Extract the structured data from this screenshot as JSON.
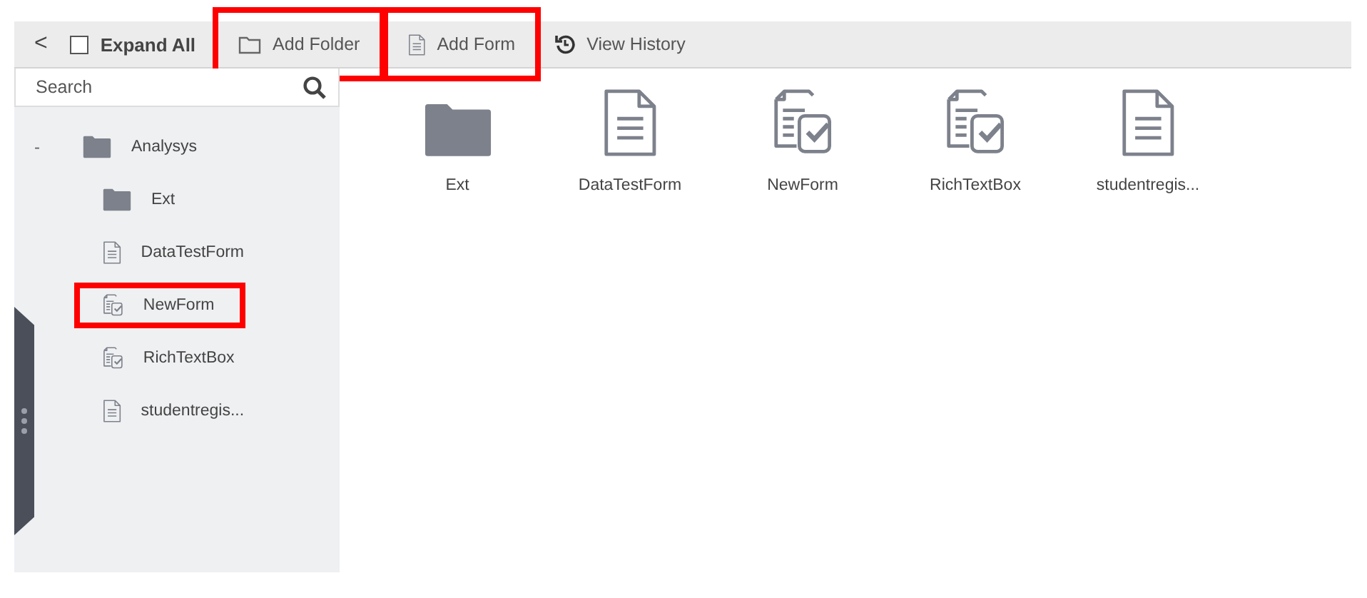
{
  "toolbar": {
    "back": "<",
    "expand_all": {
      "label": "Expand All",
      "checked": false
    },
    "buttons": [
      {
        "label": "Add Folder",
        "kind": "folder",
        "highlighted": true
      },
      {
        "label": "Add Form",
        "kind": "document",
        "highlighted": true
      },
      {
        "label": "View History",
        "kind": "history",
        "highlighted": false
      }
    ]
  },
  "search": {
    "placeholder": "Search"
  },
  "tree": [
    {
      "label": "Analysys",
      "kind": "folder",
      "expanded": true,
      "toggle": "-",
      "children": [
        {
          "label": "Ext",
          "kind": "folder",
          "highlighted": false
        },
        {
          "label": "DataTestForm",
          "kind": "document",
          "highlighted": false
        },
        {
          "label": "NewForm",
          "kind": "checklist",
          "highlighted": true
        },
        {
          "label": "RichTextBox",
          "kind": "checklist",
          "highlighted": false
        },
        {
          "label": "studentregis...",
          "kind": "document",
          "highlighted": false
        }
      ]
    }
  ],
  "items": [
    {
      "label": "Ext",
      "kind": "folder"
    },
    {
      "label": "DataTestForm",
      "kind": "document"
    },
    {
      "label": "NewForm",
      "kind": "checklist"
    },
    {
      "label": "RichTextBox",
      "kind": "checklist"
    },
    {
      "label": "studentregis...",
      "kind": "document"
    }
  ]
}
